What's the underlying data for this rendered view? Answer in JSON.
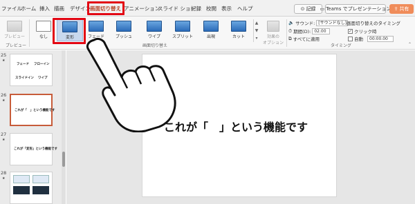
{
  "tabs": [
    {
      "label": "ファイル",
      "active": false
    },
    {
      "label": "ホーム",
      "active": false
    },
    {
      "label": "挿入",
      "active": false
    },
    {
      "label": "描画",
      "active": false
    },
    {
      "label": "デザイン",
      "active": false
    },
    {
      "label": "画面切り替え",
      "active": true
    },
    {
      "label": "アニメーション",
      "active": false
    },
    {
      "label": "スライド ショー",
      "active": false
    },
    {
      "label": "記録",
      "active": false
    },
    {
      "label": "校閲",
      "active": false
    },
    {
      "label": "表示",
      "active": false
    },
    {
      "label": "ヘルプ",
      "active": false
    }
  ],
  "title_actions": {
    "record": "記録",
    "teams": "Teams でプレゼンテーション",
    "share": "共有"
  },
  "ribbon": {
    "preview": "プレビュー",
    "preview_group": "プレビュー",
    "transitions": [
      {
        "label": "なし",
        "selected": false
      },
      {
        "label": "変形",
        "selected": true
      },
      {
        "label": "フェード",
        "selected": false
      },
      {
        "label": "プッシュ",
        "selected": false
      },
      {
        "label": "ワイプ",
        "selected": false
      },
      {
        "label": "スプリット",
        "selected": false
      },
      {
        "label": "出現",
        "selected": false
      },
      {
        "label": "カット",
        "selected": false
      }
    ],
    "transitions_group": "画面切り替え",
    "effect_options_line1": "効果の",
    "effect_options_line2": "オプション",
    "sound_label": "サウンド:",
    "sound_value": "[サウンドなし]",
    "duration_label": "期間(D):",
    "duration_value": "02.00",
    "apply_all": "すべてに適用",
    "timing_heading": "画面切り替えのタイミング",
    "on_click": "クリック時",
    "on_click_checked": true,
    "auto": "自動",
    "auto_checked": false,
    "auto_value": "00:00.00",
    "timing_group": "タイミング"
  },
  "thumbnails": [
    {
      "num": "25",
      "lines": [
        "フェード",
        "フローイン",
        "スライドイン",
        "ワイプ"
      ],
      "selected": false
    },
    {
      "num": "26",
      "lines": [
        "これが「　」という機能です"
      ],
      "selected": true
    },
    {
      "num": "27",
      "lines": [
        "これが「変形」という機能です"
      ],
      "selected": false
    },
    {
      "num": "28",
      "lines": [],
      "selected": false
    }
  ],
  "slide": {
    "text": "これが「　」という機能です"
  },
  "colors": {
    "accent": "#b7472a",
    "highlight_box": "#e30613",
    "share_button": "#f08c5a"
  }
}
